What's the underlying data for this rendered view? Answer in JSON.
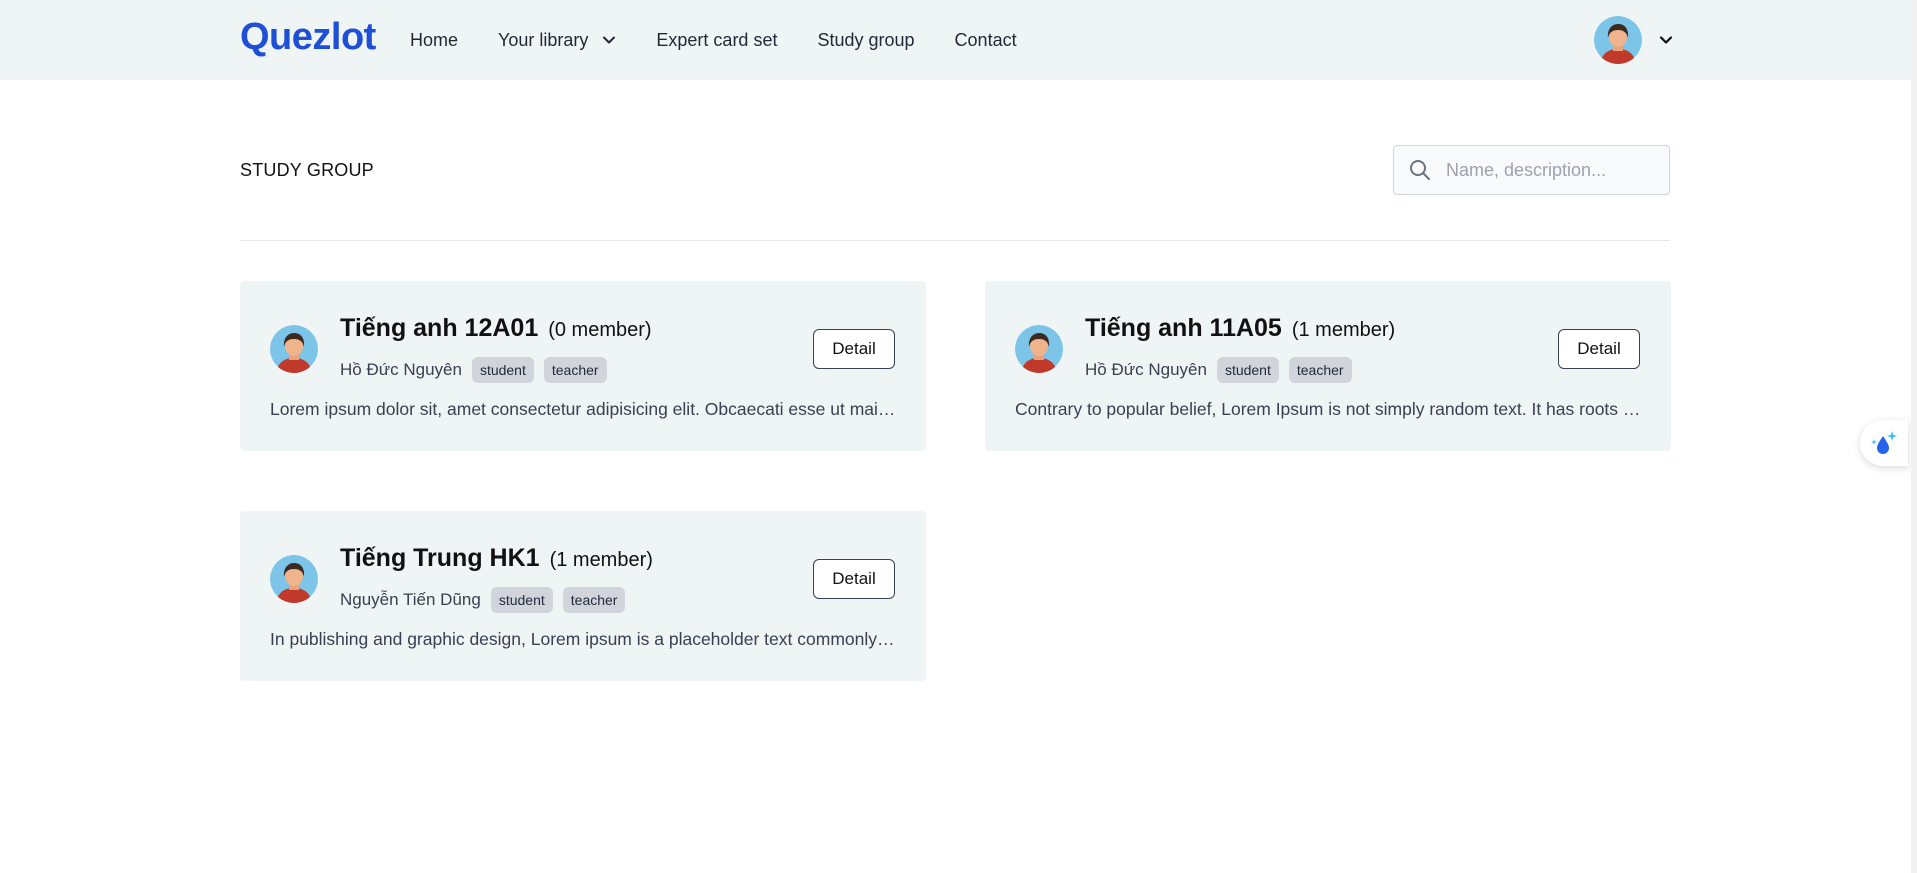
{
  "brand": {
    "name": "Quezlot",
    "color": "#1e4fd6"
  },
  "nav": {
    "home": "Home",
    "library": "Your library",
    "expert": "Expert card set",
    "study_group": "Study group",
    "contact": "Contact"
  },
  "user_menu": {
    "avatar_icon": "user-avatar"
  },
  "page": {
    "title": "STUDY GROUP",
    "search_placeholder": "Name, description..."
  },
  "groups": [
    {
      "name": "Tiếng anh 12A01",
      "members": "(0 member)",
      "owner": "Hồ Đức Nguyên",
      "tags": [
        "student",
        "teacher"
      ],
      "description": "Lorem ipsum dolor sit, amet consectetur adipisicing elit. Obcaecati esse ut maiores",
      "button": "Detail"
    },
    {
      "name": "Tiếng anh 11A05",
      "members": "(1 member)",
      "owner": "Hồ Đức Nguyên",
      "tags": [
        "student",
        "teacher"
      ],
      "description": "Contrary to popular belief, Lorem Ipsum is not simply random text. It has roots in a piece",
      "button": "Detail"
    },
    {
      "name": "Tiếng Trung HK1",
      "members": "(1 member)",
      "owner": "Nguyễn Tiến Dũng",
      "tags": [
        "student",
        "teacher"
      ],
      "description": "In publishing and graphic design, Lorem ipsum is a placeholder text commonly used",
      "button": "Detail"
    }
  ],
  "colors": {
    "header_bg": "#eff4f4",
    "card_bg": "#eff4f4",
    "tag_bg": "#d1d5db",
    "accent": "#1e4fd6"
  }
}
